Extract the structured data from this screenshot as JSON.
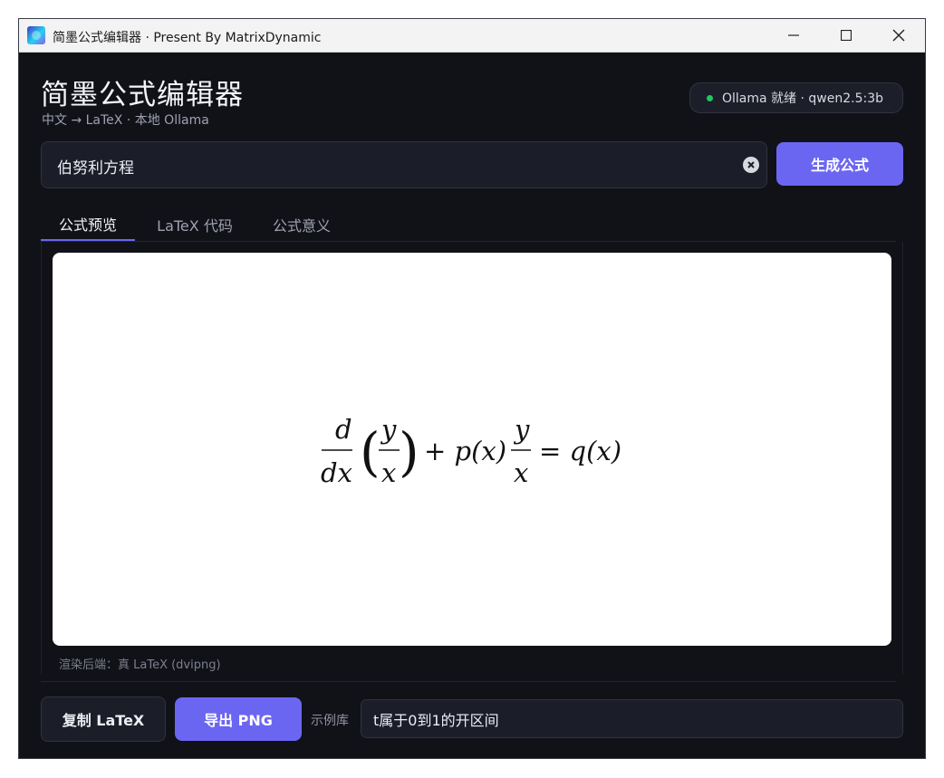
{
  "window": {
    "title": "简墨公式编辑器 · Present By MatrixDynamic"
  },
  "header": {
    "title": "简墨公式编辑器",
    "subtitle": "中文 → LaTeX · 本地 Ollama",
    "status": "Ollama 就绪 · qwen2.5:3b",
    "status_color": "#22c55e"
  },
  "query": {
    "value": "伯努利方程",
    "clear_icon": "clear-circle-icon",
    "generate_label": "生成公式"
  },
  "tabs": [
    {
      "label": "公式预览",
      "active": true
    },
    {
      "label": "LaTeX 代码",
      "active": false
    },
    {
      "label": "公式意义",
      "active": false
    }
  ],
  "preview": {
    "formula": {
      "frac1_num": "d",
      "frac1_den": "dx",
      "inner_num": "y",
      "inner_den": "x",
      "plus_term": "+ p(x)",
      "frac2_num": "y",
      "frac2_den": "x",
      "rhs": "= q(x)"
    },
    "backend": "渲染后端：真 LaTeX (dvipng)"
  },
  "footer": {
    "copy_label": "复制 LaTeX",
    "export_label": "导出 PNG",
    "examples_label": "示例库",
    "example_selected": "t属于0到1的开区间"
  },
  "colors": {
    "accent": "#6b66f2",
    "background": "#111218",
    "surface": "#1b1d28",
    "card": "#ffffff"
  }
}
